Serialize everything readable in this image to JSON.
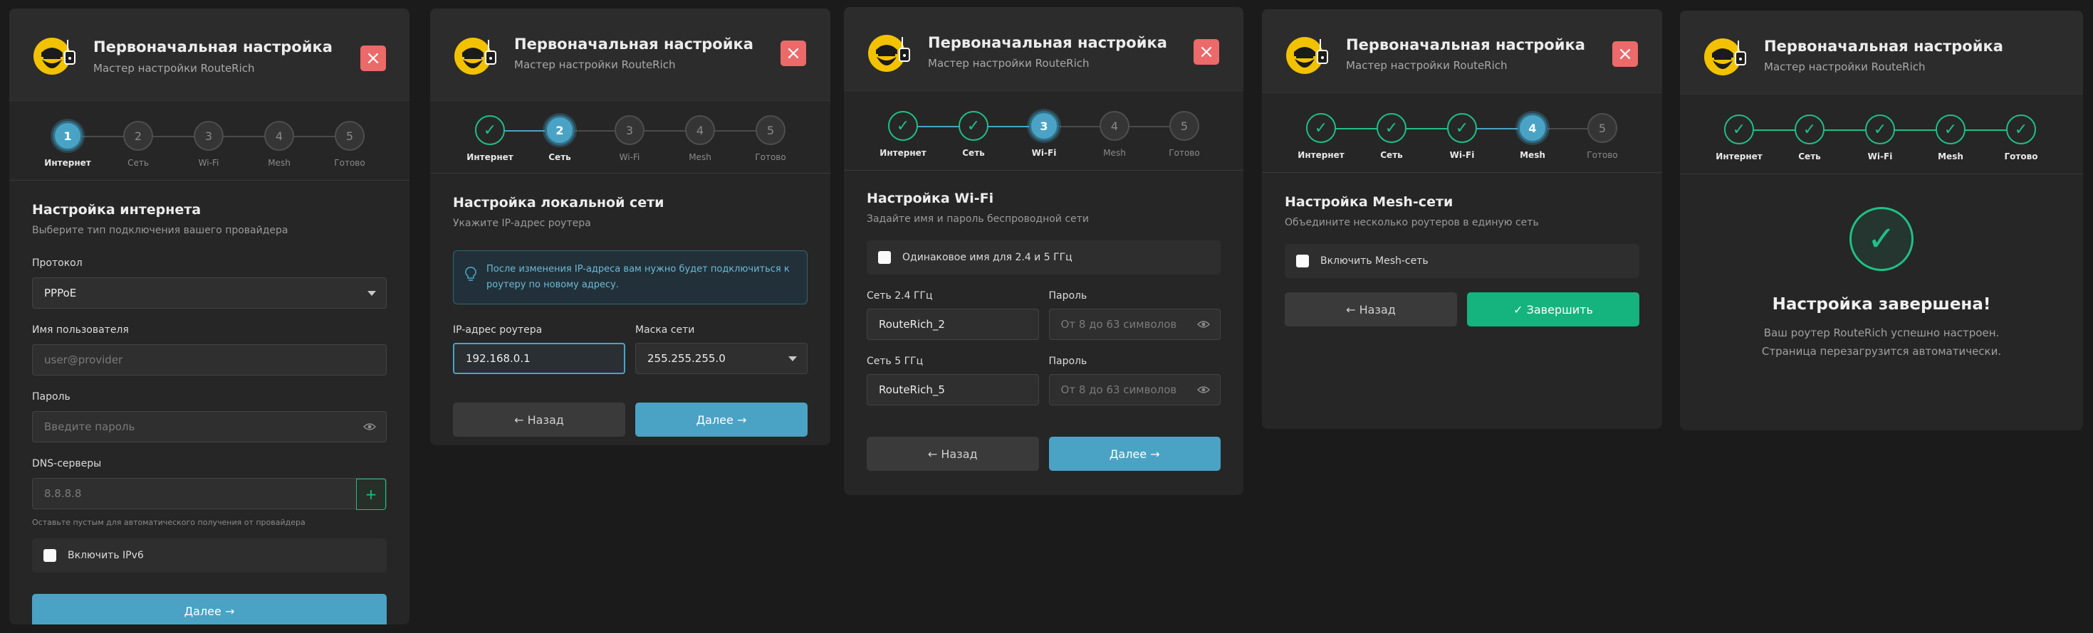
{
  "app": {
    "title": "Первоначальная настройка",
    "subtitle": "Мастер настройки RouteRich",
    "close_symbol": "×"
  },
  "steps": [
    "Интернет",
    "Сеть",
    "Wi-Fi",
    "Mesh",
    "Готово"
  ],
  "step_numbers": [
    "1",
    "2",
    "3",
    "4",
    "5"
  ],
  "check_symbol": "✓",
  "colors": {
    "accent": "#4aa3c5",
    "success": "#1fbf86",
    "danger": "#ec6a6a",
    "logo": "#f2c200"
  },
  "panel1": {
    "title": "Настройка интернета",
    "subtitle": "Выберите тип подключения вашего провайдера",
    "protocol_label": "Протокол",
    "protocol_value": "PPPoE",
    "username_label": "Имя пользователя",
    "username_placeholder": "user@provider",
    "password_label": "Пароль",
    "password_placeholder": "Введите пароль",
    "dns_label": "DNS-серверы",
    "dns_placeholder": "8.8.8.8",
    "dns_add": "+",
    "dns_hint": "Оставьте пустым для автоматического получения от провайдера",
    "ipv6_label": "Включить IPv6",
    "next_button": "Далее →"
  },
  "panel2": {
    "title": "Настройка локальной сети",
    "subtitle": "Укажите IP-адрес роутера",
    "info_line1": "После изменения IP-адреса вам нужно будет подключиться к",
    "info_line2": "роутеру по новому адресу.",
    "ip_label": "IP-адрес роутера",
    "ip_value": "192.168.0.1",
    "mask_label": "Маска сети",
    "mask_value": "255.255.255.0",
    "back_button": "← Назад",
    "next_button": "Далее →"
  },
  "panel3": {
    "title": "Настройка Wi-Fi",
    "subtitle": "Задайте имя и пароль беспроводной сети",
    "same_name_label": "Одинаковое имя для 2.4 и 5 ГГц",
    "ssid24_label": "Сеть 2.4 ГГц",
    "ssid24_value": "RouteRich_2",
    "pass24_label": "Пароль",
    "pass_placeholder": "От 8 до 63 символов",
    "ssid5_label": "Сеть 5 ГГц",
    "ssid5_value": "RouteRich_5",
    "pass5_label": "Пароль",
    "back_button": "← Назад",
    "next_button": "Далее →"
  },
  "panel4": {
    "title": "Настройка Mesh-сети",
    "subtitle": "Объедините несколько роутеров в единую сеть",
    "mesh_label": "Включить Mesh-сеть",
    "back_button": "← Назад",
    "finish_button": "✓ Завершить"
  },
  "panel5": {
    "title": "Настройка завершена!",
    "line1": "Ваш роутер RouteRich успешно настроен.",
    "line2": "Страница перезагрузится автоматически.",
    "check": "✓"
  }
}
